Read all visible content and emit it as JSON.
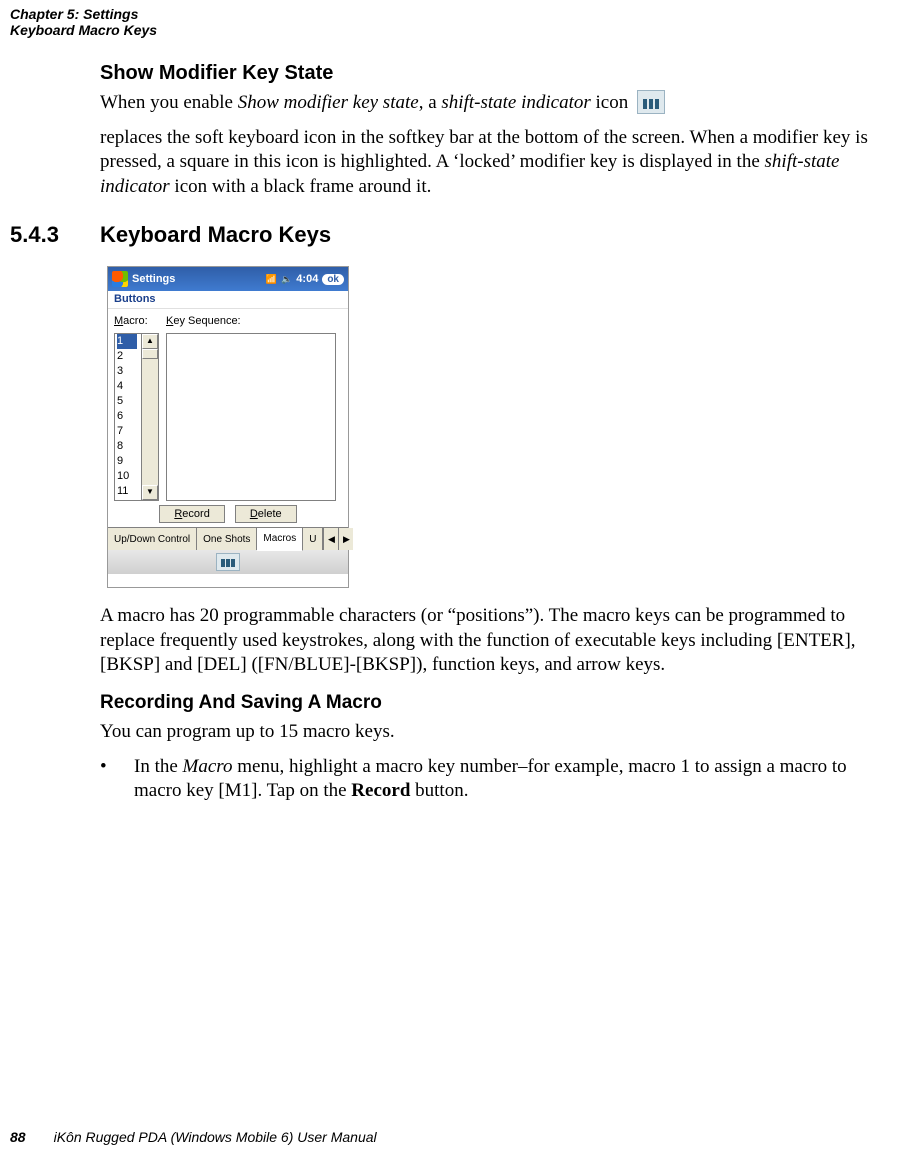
{
  "header": {
    "chapter": "Chapter 5:  Settings",
    "section": "Keyboard Macro Keys"
  },
  "show_modifier": {
    "heading": "Show Modifier Key State",
    "p1_a": "When you enable ",
    "p1_i1": "Show modifier key state",
    "p1_b": ", a ",
    "p1_i2": "shift-state indicator",
    "p1_c": " icon ",
    "p2_a": " replaces the soft keyboard icon in the softkey bar at the bottom of the screen. When a modifier key is pressed, a square in this icon is highlighted. A ‘locked’ modifier key is displayed in the ",
    "p2_i1": "shift-state indicator",
    "p2_b": " icon with a black frame around it."
  },
  "section": {
    "number": "5.4.3",
    "title": "Keyboard Macro Keys"
  },
  "macro_para": "A macro has 20 programmable characters (or “positions”). The macro keys can be programmed to replace frequently used keystrokes, along with the function of executable keys including [ENTER], [BKSP] and [DEL] ([FN/BLUE]-[BKSP]), function keys, and arrow keys.",
  "recording": {
    "heading": "Recording And Saving A Macro",
    "p1": "You can program up to 15 macro keys.",
    "bullet_a": "In the ",
    "bullet_i": "Macro",
    "bullet_b": " menu, highlight a macro key number–for example, macro 1 to assign a macro to macro key [M1]. Tap on the ",
    "bullet_bold": "Record",
    "bullet_c": " button."
  },
  "device": {
    "topbar_title": "Settings",
    "topbar_time": "4:04",
    "topbar_ok": "ok",
    "subtitle": "Buttons",
    "label_macro_pre": "M",
    "label_macro_rest": "acro:",
    "label_keyseq_pre": "K",
    "label_keyseq_rest": "ey Sequence:",
    "list": [
      "1",
      "2",
      "3",
      "4",
      "5",
      "6",
      "7",
      "8",
      "9",
      "10",
      "11"
    ],
    "btn_record_u": "R",
    "btn_record_rest": "ecord",
    "btn_delete_u": "D",
    "btn_delete_rest": "elete",
    "tabs": {
      "t1": "Up/Down Control",
      "t2": "One Shots",
      "active": "Macros",
      "t4": "U"
    }
  },
  "footer": {
    "page": "88",
    "title": "iKôn Rugged PDA (Windows Mobile 6) User Manual"
  }
}
